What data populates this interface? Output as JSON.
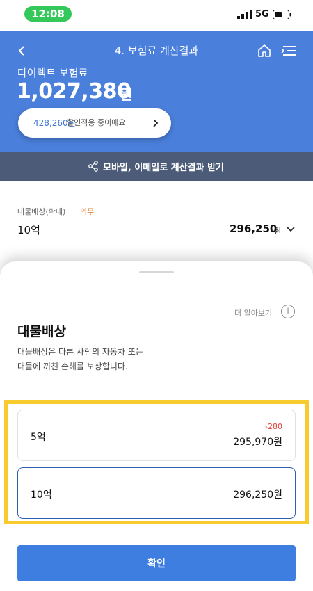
{
  "status_bar": {
    "time": "12:08",
    "network": "5G"
  },
  "header": {
    "title": "4. 보험료 계산결과",
    "premium_label": "다이렉트 보험료",
    "premium_amount": "1,027,380",
    "premium_unit": "원",
    "discount_amount": "428,260원",
    "discount_text": "할인적용 중이에요"
  },
  "share_bar": {
    "label": "모바일, 이메일로 계산결과 받기"
  },
  "coverage_row": {
    "label": "대물배상(확대)",
    "badge": "의무",
    "value": "10억",
    "price": "296,250",
    "unit": "원"
  },
  "sheet": {
    "learn_more": "더 알아보기",
    "info_glyph": "i",
    "title": "대물배상",
    "description_line1": "대물배상은 다른 사람의 자동차 또는",
    "description_line2": "대물에 끼친 손해를 보상합니다.",
    "options": [
      {
        "name": "5억",
        "difference": "-280",
        "price": "295,970원",
        "selected": false
      },
      {
        "name": "10억",
        "difference": "",
        "price": "296,250원",
        "selected": true
      }
    ],
    "confirm_label": "확인"
  },
  "colors": {
    "brand_blue": "#4a7fdb",
    "share_bar": "#4b5b78",
    "highlight": "#f7cb2e",
    "negative": "#e3413a",
    "badge_orange": "#e07a2e",
    "button_blue": "#3e7ee0"
  },
  "icons": {
    "back": "chevron-left-icon",
    "home": "home-icon",
    "menu": "menu-icon",
    "share": "share-icon",
    "info": "info-icon",
    "chevron_down": "chevron-down-icon",
    "chevron_right": "chevron-right-icon"
  }
}
